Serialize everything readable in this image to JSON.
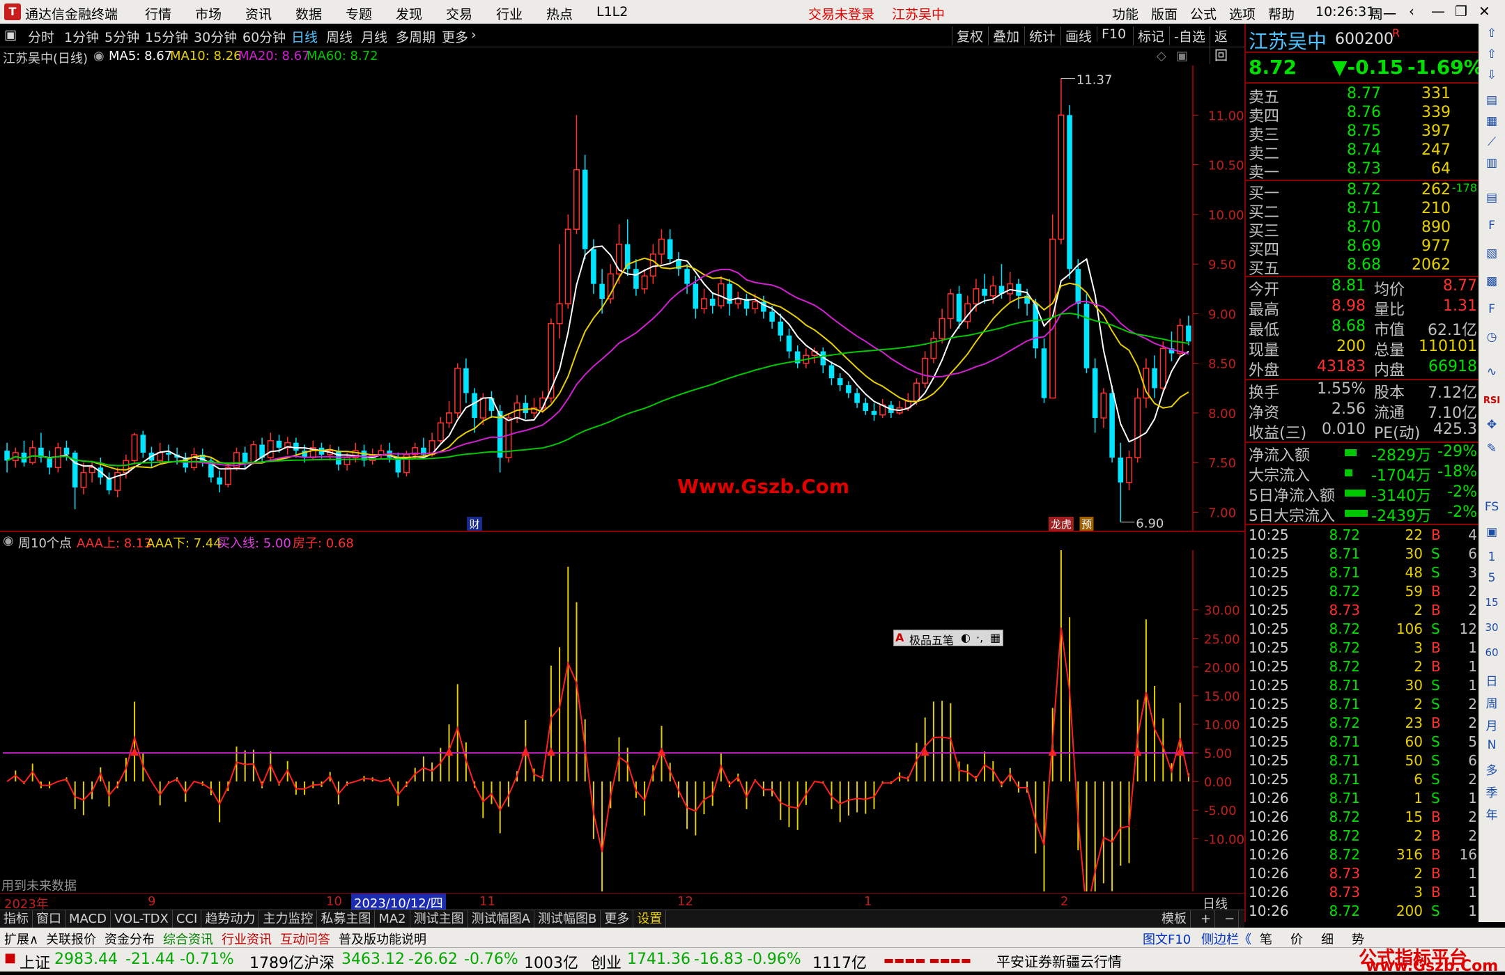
{
  "titlebar": {
    "app_name": "通达信金融终端",
    "menu": [
      "行情",
      "市场",
      "资讯",
      "数据",
      "专题",
      "发现",
      "交易",
      "行业",
      "热点",
      "L1L2"
    ],
    "login_status": "交易未登录",
    "stock_name": "江苏吴中",
    "right_menu": [
      "功能",
      "版面",
      "公式",
      "选项",
      "帮助"
    ],
    "time": "10:26:31",
    "weekday": "周一"
  },
  "periods": [
    "分时",
    "1分钟",
    "5分钟",
    "15分钟",
    "30分钟",
    "60分钟",
    "日线",
    "周线",
    "月线",
    "多周期",
    "更多"
  ],
  "selected_period": "日线",
  "toolbar_buttons": [
    "复权",
    "叠加",
    "统计",
    "画线",
    "F10",
    "标记",
    "-自选",
    "返回"
  ],
  "ma_legend": {
    "name": "江苏吴中(日线)",
    "ma5": "MA5: 8.67",
    "ma10": "MA10: 8.26",
    "ma20": "MA20: 8.67",
    "ma60": "MA60: 8.72"
  },
  "price_axis": [
    "11.00",
    "10.50",
    "10.00",
    "9.50",
    "9.00",
    "8.50",
    "8.00",
    "7.50",
    "7.00"
  ],
  "high_label": "11.37",
  "low_label": "6.90",
  "event_labels": {
    "cai": "财",
    "longhu": "龙虎",
    "yu": "预"
  },
  "watermark": "Www.Gszb.Com",
  "indicator_legend": {
    "name": "周10个点",
    "aaa_up": "AAA上: 8.13",
    "aaa_down": "AAA下: 7.44",
    "buy_line": "买入线: 5.00",
    "fangzi": "房子: 0.68"
  },
  "indicator_axis": [
    "30.00",
    "25.00",
    "20.00",
    "15.00",
    "10.00",
    "5.00",
    "0.00",
    "-5.00",
    "-10.00"
  ],
  "float_toolbar": "极品五笔",
  "future_data_note": "用到未来数据",
  "time_axis": [
    "2023年",
    "9",
    "10",
    "2023/10/12/四",
    "11",
    "12",
    "1",
    "2"
  ],
  "time_axis_right": "日线",
  "tabs": [
    "指标",
    "窗口",
    "MACD",
    "VOL-TDX",
    "CCI",
    "趋势动力",
    "主力监控",
    "私募主图",
    "MA2",
    "测试主图",
    "测试幅图A",
    "测试幅图B",
    "更多",
    "设置"
  ],
  "tabs_right": [
    "模板",
    "+",
    "−"
  ],
  "bottom_tabs": [
    "扩展∧",
    "关联报价",
    "资金分布",
    "综合资讯",
    "行业资讯",
    "互动问答",
    "普及版功能说明"
  ],
  "bottom_right": [
    "图文F10",
    "侧边栏《",
    "笔",
    "价",
    "细",
    "势"
  ],
  "quote": {
    "name": "江苏吴中",
    "code": "600200",
    "r": "R",
    "price": "8.72",
    "change": "▼-0.15",
    "change_pct": "-1.69%",
    "sells": [
      {
        "label": "卖五",
        "price": "8.77",
        "vol": "331"
      },
      {
        "label": "卖四",
        "price": "8.76",
        "vol": "339"
      },
      {
        "label": "卖三",
        "price": "8.75",
        "vol": "397"
      },
      {
        "label": "卖二",
        "price": "8.74",
        "vol": "247"
      },
      {
        "label": "卖一",
        "price": "8.73",
        "vol": "64"
      }
    ],
    "buys": [
      {
        "label": "买一",
        "price": "8.72",
        "vol": "262",
        "diff": "-178"
      },
      {
        "label": "买二",
        "price": "8.71",
        "vol": "210",
        "diff": ""
      },
      {
        "label": "买三",
        "price": "8.70",
        "vol": "890",
        "diff": ""
      },
      {
        "label": "买四",
        "price": "8.69",
        "vol": "977",
        "diff": ""
      },
      {
        "label": "买五",
        "price": "8.68",
        "vol": "2062",
        "diff": ""
      }
    ],
    "stats": [
      {
        "l1": "今开",
        "v1": "8.81",
        "l2": "均价",
        "v2": "8.77"
      },
      {
        "l1": "最高",
        "v1": "8.98",
        "l2": "量比",
        "v2": "1.31"
      },
      {
        "l1": "最低",
        "v1": "8.68",
        "l2": "市值",
        "v2": "62.1亿"
      },
      {
        "l1": "现量",
        "v1": "200",
        "l2": "总量",
        "v2": "110101"
      },
      {
        "l1": "外盘",
        "v1": "43183",
        "l2": "内盘",
        "v2": "66918"
      }
    ],
    "stats2": [
      {
        "l1": "换手",
        "v1": "1.55%",
        "l2": "股本",
        "v2": "7.12亿"
      },
      {
        "l1": "净资",
        "v1": "2.56",
        "l2": "流通",
        "v2": "7.10亿"
      },
      {
        "l1": "收益(三)",
        "v1": "0.010",
        "l2": "PE(动)",
        "v2": "425.3"
      }
    ],
    "flows": [
      {
        "label": "净流入额",
        "value": "-2829万",
        "pct": "-29%",
        "bar": 0.29
      },
      {
        "label": "大宗流入",
        "value": "-1704万",
        "pct": "-18%",
        "bar": 0.18
      },
      {
        "label": "5日净流入额",
        "value": "-3140万",
        "pct": "-2%",
        "bar": 0.5
      },
      {
        "label": "5日大宗流入",
        "value": "-2439万",
        "pct": "-2%",
        "bar": 0.55
      }
    ],
    "ticks": [
      {
        "t": "10:25",
        "p": "8.72",
        "v": "22",
        "d": "B",
        "n": "4"
      },
      {
        "t": "10:25",
        "p": "8.71",
        "v": "30",
        "d": "S",
        "n": "6"
      },
      {
        "t": "10:25",
        "p": "8.71",
        "v": "48",
        "d": "S",
        "n": "3"
      },
      {
        "t": "10:25",
        "p": "8.72",
        "v": "59",
        "d": "B",
        "n": "2"
      },
      {
        "t": "10:25",
        "p": "8.73",
        "v": "2",
        "d": "B",
        "n": "2"
      },
      {
        "t": "10:25",
        "p": "8.72",
        "v": "106",
        "d": "S",
        "n": "12"
      },
      {
        "t": "10:25",
        "p": "8.72",
        "v": "3",
        "d": "B",
        "n": "1"
      },
      {
        "t": "10:25",
        "p": "8.72",
        "v": "2",
        "d": "B",
        "n": "1"
      },
      {
        "t": "10:25",
        "p": "8.71",
        "v": "30",
        "d": "S",
        "n": "1"
      },
      {
        "t": "10:25",
        "p": "8.71",
        "v": "2",
        "d": "S",
        "n": "2"
      },
      {
        "t": "10:25",
        "p": "8.72",
        "v": "23",
        "d": "B",
        "n": "2"
      },
      {
        "t": "10:25",
        "p": "8.71",
        "v": "60",
        "d": "S",
        "n": "5"
      },
      {
        "t": "10:25",
        "p": "8.71",
        "v": "50",
        "d": "S",
        "n": "6"
      },
      {
        "t": "10:25",
        "p": "8.71",
        "v": "6",
        "d": "S",
        "n": "2"
      },
      {
        "t": "10:26",
        "p": "8.71",
        "v": "1",
        "d": "S",
        "n": "1"
      },
      {
        "t": "10:26",
        "p": "8.72",
        "v": "15",
        "d": "B",
        "n": "2"
      },
      {
        "t": "10:26",
        "p": "8.72",
        "v": "2",
        "d": "B",
        "n": "2"
      },
      {
        "t": "10:26",
        "p": "8.72",
        "v": "316",
        "d": "B",
        "n": "16"
      },
      {
        "t": "10:26",
        "p": "8.73",
        "v": "2",
        "d": "B",
        "n": "1"
      },
      {
        "t": "10:26",
        "p": "8.73",
        "v": "3",
        "d": "B",
        "n": "1"
      },
      {
        "t": "10:26",
        "p": "8.72",
        "v": "200",
        "d": "S",
        "n": "1"
      }
    ]
  },
  "sidebar_labels": [
    "RSI",
    "FS",
    "1",
    "5",
    "15",
    "30",
    "60",
    "日",
    "周",
    "月",
    "N",
    "多",
    "季",
    "年"
  ],
  "status": {
    "items": [
      {
        "name": "上证",
        "value": "2983.44",
        "chg": "-21.44",
        "pct": "-0.71%",
        "amt": "1789亿"
      },
      {
        "name": "沪深",
        "value": "3463.12",
        "chg": "-26.62",
        "pct": "-0.76%",
        "amt": "1003亿"
      },
      {
        "name": "创业",
        "value": "1741.36",
        "chg": "-16.83",
        "pct": "-0.96%",
        "amt": "1117亿"
      }
    ],
    "broker": "平安证券新疆云行情",
    "watermark": "公式指标平台",
    "watermark_url": "www.Gszb.Com"
  },
  "colors": {
    "up": "#ff3030",
    "down": "#00e5ff",
    "ma5": "#ffffff",
    "ma10": "#e8d000",
    "ma20": "#d020d0",
    "ma60": "#00c800",
    "buyline": "#c020c0"
  },
  "chart_data": {
    "type": "candlestick",
    "title": "江苏吴中(日线)",
    "ylim": [
      6.8,
      11.5
    ],
    "candles": [
      [
        7.62,
        7.52,
        7.7,
        7.4
      ],
      [
        7.52,
        7.6,
        7.65,
        7.45
      ],
      [
        7.6,
        7.5,
        7.72,
        7.46
      ],
      [
        7.5,
        7.65,
        7.72,
        7.48
      ],
      [
        7.65,
        7.55,
        7.8,
        7.5
      ],
      [
        7.55,
        7.45,
        7.62,
        7.38
      ],
      [
        7.45,
        7.65,
        7.7,
        7.4
      ],
      [
        7.65,
        7.58,
        7.72,
        7.52
      ],
      [
        7.6,
        7.25,
        7.62,
        7.03
      ],
      [
        7.25,
        7.4,
        7.5,
        7.18
      ],
      [
        7.4,
        7.45,
        7.52,
        7.3
      ],
      [
        7.45,
        7.35,
        7.55,
        7.28
      ],
      [
        7.35,
        7.22,
        7.4,
        7.18
      ],
      [
        7.22,
        7.4,
        7.45,
        7.15
      ],
      [
        7.4,
        7.52,
        7.58,
        7.34
      ],
      [
        7.52,
        7.78,
        7.8,
        7.48
      ],
      [
        7.78,
        7.6,
        7.82,
        7.55
      ],
      [
        7.6,
        7.52,
        7.66,
        7.45
      ],
      [
        7.52,
        7.6,
        7.7,
        7.48
      ],
      [
        7.6,
        7.58,
        7.68,
        7.5
      ],
      [
        7.58,
        7.55,
        7.65,
        7.48
      ],
      [
        7.55,
        7.45,
        7.6,
        7.4
      ],
      [
        7.45,
        7.58,
        7.65,
        7.42
      ],
      [
        7.58,
        7.52,
        7.64,
        7.46
      ],
      [
        7.52,
        7.35,
        7.55,
        7.3
      ],
      [
        7.35,
        7.28,
        7.42,
        7.2
      ],
      [
        7.28,
        7.45,
        7.5,
        7.25
      ],
      [
        7.45,
        7.6,
        7.65,
        7.42
      ],
      [
        7.6,
        7.5,
        7.66,
        7.44
      ],
      [
        7.5,
        7.68,
        7.72,
        7.48
      ],
      [
        7.68,
        7.55,
        7.75,
        7.5
      ],
      [
        7.55,
        7.72,
        7.8,
        7.52
      ],
      [
        7.72,
        7.65,
        7.78,
        7.6
      ],
      [
        7.65,
        7.7,
        7.76,
        7.58
      ],
      [
        7.7,
        7.62,
        7.75,
        7.55
      ],
      [
        7.62,
        7.55,
        7.68,
        7.5
      ],
      [
        7.55,
        7.65,
        7.72,
        7.52
      ],
      [
        7.65,
        7.58,
        7.7,
        7.54
      ],
      [
        7.58,
        7.62,
        7.68,
        7.52
      ],
      [
        7.62,
        7.48,
        7.66,
        7.42
      ],
      [
        7.48,
        7.55,
        7.6,
        7.42
      ],
      [
        7.55,
        7.62,
        7.7,
        7.5
      ],
      [
        7.62,
        7.52,
        7.68,
        7.46
      ],
      [
        7.52,
        7.58,
        7.64,
        7.48
      ],
      [
        7.58,
        7.62,
        7.68,
        7.54
      ],
      [
        7.62,
        7.55,
        7.7,
        7.5
      ],
      [
        7.55,
        7.4,
        7.6,
        7.35
      ],
      [
        7.4,
        7.58,
        7.62,
        7.36
      ],
      [
        7.58,
        7.65,
        7.7,
        7.54
      ],
      [
        7.65,
        7.58,
        7.75,
        7.55
      ],
      [
        7.58,
        7.72,
        7.8,
        7.56
      ],
      [
        7.72,
        7.9,
        7.96,
        7.7
      ],
      [
        7.9,
        8.0,
        8.12,
        7.85
      ],
      [
        8.0,
        8.45,
        8.5,
        7.95
      ],
      [
        8.45,
        8.2,
        8.55,
        8.1
      ],
      [
        8.2,
        7.95,
        8.25,
        7.8
      ],
      [
        7.95,
        8.15,
        8.2,
        7.88
      ],
      [
        8.15,
        8.02,
        8.22,
        7.95
      ],
      [
        8.02,
        7.55,
        8.08,
        7.4
      ],
      [
        7.55,
        7.95,
        8.0,
        7.5
      ],
      [
        7.95,
        8.1,
        8.18,
        7.9
      ],
      [
        8.1,
        8.0,
        8.18,
        7.94
      ],
      [
        8.0,
        8.05,
        8.15,
        7.95
      ],
      [
        8.05,
        8.15,
        8.22,
        8.0
      ],
      [
        8.15,
        8.9,
        8.95,
        8.1
      ],
      [
        8.9,
        9.1,
        9.7,
        8.75
      ],
      [
        9.1,
        9.85,
        10.0,
        9.05
      ],
      [
        9.85,
        10.45,
        11.0,
        9.8
      ],
      [
        10.45,
        9.65,
        10.6,
        9.55
      ],
      [
        9.65,
        9.3,
        9.75,
        9.2
      ],
      [
        9.3,
        9.15,
        9.45,
        9.0
      ],
      [
        9.15,
        9.4,
        9.5,
        9.1
      ],
      [
        9.4,
        9.7,
        9.9,
        9.3
      ],
      [
        9.7,
        9.45,
        9.95,
        9.38
      ],
      [
        9.45,
        9.25,
        9.55,
        9.18
      ],
      [
        9.25,
        9.38,
        9.45,
        9.2
      ],
      [
        9.38,
        9.6,
        9.7,
        9.3
      ],
      [
        9.6,
        9.75,
        9.85,
        9.5
      ],
      [
        9.75,
        9.55,
        9.85,
        9.5
      ],
      [
        9.55,
        9.45,
        9.62,
        9.38
      ],
      [
        9.45,
        9.3,
        9.5,
        9.2
      ],
      [
        9.3,
        9.05,
        9.38,
        8.95
      ],
      [
        9.05,
        9.15,
        9.25,
        9.0
      ],
      [
        9.15,
        9.08,
        9.22,
        9.0
      ],
      [
        9.08,
        9.3,
        9.38,
        9.05
      ],
      [
        9.3,
        9.1,
        9.35,
        8.98
      ],
      [
        9.1,
        9.15,
        9.22,
        9.05
      ],
      [
        9.15,
        9.05,
        9.2,
        8.98
      ],
      [
        9.05,
        9.12,
        9.2,
        9.0
      ],
      [
        9.12,
        9.02,
        9.18,
        8.95
      ],
      [
        9.02,
        8.92,
        9.08,
        8.85
      ],
      [
        8.92,
        8.78,
        9.0,
        8.72
      ],
      [
        8.78,
        8.62,
        8.85,
        8.55
      ],
      [
        8.62,
        8.5,
        8.68,
        8.45
      ],
      [
        8.5,
        8.58,
        8.65,
        8.45
      ],
      [
        8.58,
        8.62,
        8.66,
        8.5
      ],
      [
        8.62,
        8.48,
        8.66,
        8.4
      ],
      [
        8.48,
        8.35,
        8.52,
        8.28
      ],
      [
        8.35,
        8.28,
        8.4,
        8.22
      ],
      [
        8.28,
        8.2,
        8.32,
        8.15
      ],
      [
        8.2,
        8.1,
        8.25,
        8.05
      ],
      [
        8.1,
        8.02,
        8.15,
        7.98
      ],
      [
        8.02,
        7.98,
        8.1,
        7.92
      ],
      [
        7.98,
        8.08,
        8.14,
        7.95
      ],
      [
        8.08,
        8.0,
        8.12,
        7.95
      ],
      [
        8.0,
        8.05,
        8.12,
        7.98
      ],
      [
        8.05,
        8.12,
        8.2,
        8.02
      ],
      [
        8.12,
        8.3,
        8.35,
        8.08
      ],
      [
        8.3,
        8.55,
        8.62,
        8.25
      ],
      [
        8.55,
        8.75,
        8.82,
        8.5
      ],
      [
        8.75,
        8.95,
        9.05,
        8.7
      ],
      [
        8.95,
        9.2,
        9.25,
        8.85
      ],
      [
        9.2,
        8.92,
        9.28,
        8.85
      ],
      [
        8.92,
        9.1,
        9.18,
        8.85
      ],
      [
        9.1,
        9.25,
        9.35,
        9.02
      ],
      [
        9.25,
        9.18,
        9.4,
        9.1
      ],
      [
        9.18,
        9.28,
        9.38,
        9.1
      ],
      [
        9.28,
        9.2,
        9.5,
        9.15
      ],
      [
        9.2,
        9.3,
        9.42,
        9.12
      ],
      [
        9.3,
        9.18,
        9.35,
        9.05
      ],
      [
        9.18,
        9.1,
        9.25,
        8.98
      ],
      [
        9.1,
        8.65,
        9.15,
        8.55
      ],
      [
        8.65,
        8.15,
        8.75,
        8.1
      ],
      [
        8.15,
        9.75,
        10.0,
        9.0
      ],
      [
        9.75,
        11.0,
        11.37,
        9.7
      ],
      [
        11.0,
        9.45,
        11.1,
        9.35
      ],
      [
        9.45,
        9.1,
        9.55,
        8.95
      ],
      [
        9.1,
        8.45,
        9.2,
        8.4
      ],
      [
        8.45,
        7.95,
        8.55,
        7.8
      ],
      [
        7.95,
        8.2,
        8.25,
        7.85
      ],
      [
        8.2,
        7.55,
        8.28,
        7.5
      ],
      [
        7.55,
        7.3,
        7.7,
        6.9
      ],
      [
        7.3,
        7.55,
        7.62,
        7.22
      ],
      [
        7.55,
        8.15,
        8.25,
        7.5
      ],
      [
        8.15,
        8.45,
        8.55,
        8.05
      ],
      [
        8.45,
        8.25,
        8.58,
        8.15
      ],
      [
        8.25,
        8.65,
        8.72,
        8.2
      ],
      [
        8.65,
        8.6,
        8.82,
        8.52
      ],
      [
        8.6,
        8.88,
        8.95,
        8.55
      ],
      [
        8.88,
        8.72,
        8.98,
        8.68
      ]
    ],
    "indicator": {
      "name": "周10个点",
      "buy_line": 5.0
    }
  }
}
